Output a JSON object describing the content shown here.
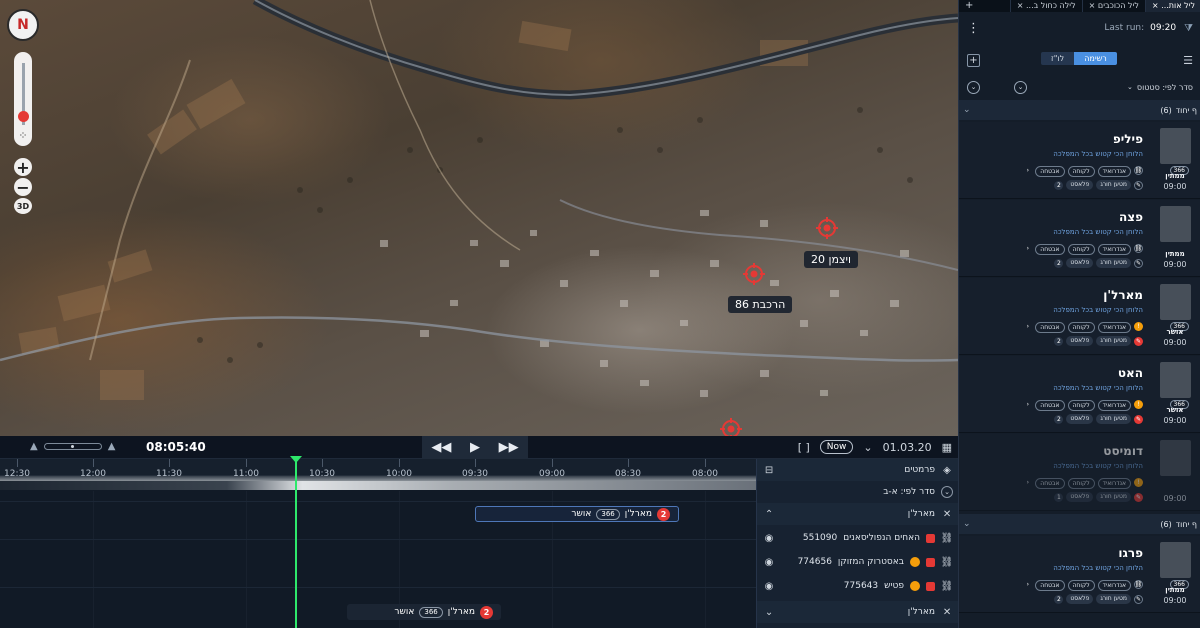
{
  "map": {
    "compass_letter": "N",
    "zoom_in_label": "+",
    "zoom_out_label": "−",
    "mode_3d_label": "3D",
    "markers": [
      {
        "label": "ויצמן 20"
      },
      {
        "label": "הרכבת 86"
      },
      {
        "label": ""
      }
    ]
  },
  "timeline": {
    "current_time": "08:05:40",
    "now_label": "Now",
    "date": "01.03.20",
    "bracket_label": "[ ]",
    "ticks": [
      "12:30",
      "12:00",
      "11:30",
      "11:00",
      "10:30",
      "10:00",
      "09:30",
      "09:00",
      "08:30",
      "08:00"
    ],
    "events": [
      {
        "name": "מארל'ן",
        "count": "2",
        "code": "366",
        "status": "אושר"
      },
      {
        "name": "מארל'ן",
        "count": "2",
        "code": "366",
        "status": "אושר"
      }
    ]
  },
  "layers": {
    "title": "פרמטים",
    "sort_label": "סדר לפי: א-ב",
    "group1": "מארל'ן",
    "items": [
      {
        "name": "האחים הנפוליסאנים",
        "id": "551090",
        "color": "#e53935"
      },
      {
        "name": "באסטרוק המזוקן",
        "id": "774656",
        "color": "#f59e0b"
      },
      {
        "name": "פטיש",
        "id": "775643",
        "color": "#f59e0b"
      }
    ],
    "group2": "מארל'ן"
  },
  "sidebar": {
    "tabs": [
      {
        "label": "ליל אות...",
        "active": true
      },
      {
        "label": "ליל הכוכבים",
        "active": false
      },
      {
        "label": "לילה כחול ב...",
        "active": false
      }
    ],
    "last_run_label": "Last run:",
    "last_run_time": "09:20",
    "seg_list": "רשימה",
    "seg_map": "לו\"ז",
    "filter_label": "סדר לפי: סטטוס",
    "group1_label": "ף יחוד",
    "group1_count": "(6)",
    "group2_label": "ף יחוד",
    "group2_count": "(6)",
    "cards": [
      {
        "name": "פיליפ",
        "subtitle": "הלוחן הכי קטוש בכל המפלכה",
        "chips1": [
          "אבטחה",
          "לקוחה",
          "אנדרואיד"
        ],
        "chips2": [
          "מטען חורג",
          "פלאסט"
        ],
        "badge": "366",
        "role": "ממתין",
        "time": "09:00",
        "num": "2"
      },
      {
        "name": "פצה",
        "subtitle": "הלוחן הכי קטוש בכל המפלכה",
        "chips1": [
          "אבטחה",
          "לקוחה",
          "אנדרואיד"
        ],
        "chips2": [
          "מטען חורג",
          "פלאסט"
        ],
        "badge": "",
        "role": "ממתין",
        "time": "09:00",
        "num": "2"
      },
      {
        "name": "מארל'ן",
        "subtitle": "הלוחן הכי קטוש בכל המפלכה",
        "chips1": [
          "אבטחה",
          "לקוחה",
          "אנדרואיד"
        ],
        "chips2": [
          "מטען חורג",
          "פלאסט"
        ],
        "badge": "366",
        "role": "אושר",
        "time": "09:00",
        "num": "2"
      },
      {
        "name": "האט",
        "subtitle": "הלוחן הכי קטוש בכל המפלכה",
        "chips1": [
          "אבטחה",
          "לקוחה",
          "אנדרואיד"
        ],
        "chips2": [
          "מטען חורג",
          "פלאסט"
        ],
        "badge": "366",
        "role": "אושר",
        "time": "09:00",
        "num": "2"
      },
      {
        "name": "דומיסט",
        "subtitle": "הלוחן הכי קטוש בכל המפלכה",
        "chips1": [
          "אבטחה",
          "לקוחה",
          "אנדרואיד"
        ],
        "chips2": [
          "מטען חורג",
          "פלאסט"
        ],
        "badge": "",
        "role": "",
        "time": "09:00",
        "num": "1"
      },
      {
        "name": "פרגו",
        "subtitle": "הלוחן הכי קטוש בכל המפלכה",
        "chips1": [
          "אבטחה",
          "לקוחה",
          "אנדרואיד"
        ],
        "chips2": [
          "מטען חורג",
          "פלאסט"
        ],
        "badge": "366",
        "role": "ממתין",
        "time": "09:00",
        "num": "2"
      }
    ]
  },
  "colors": {
    "accent": "#4a90e2",
    "danger": "#e53935",
    "playhead": "#2ee86b",
    "warning": "#f59e0b"
  }
}
